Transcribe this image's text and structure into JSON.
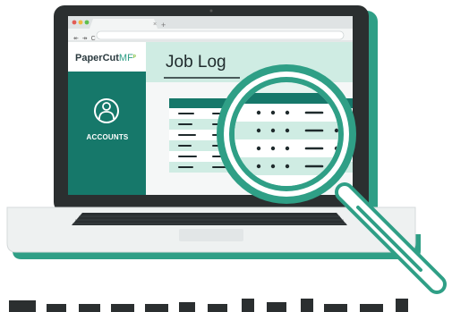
{
  "browser": {
    "tab_close": "×",
    "new_tab": "+",
    "nav_controls": "↞ ↠ C"
  },
  "app": {
    "logo_main": "PaperCut",
    "logo_suffix": "MF",
    "logo_mark": "ᵖ"
  },
  "sidebar": {
    "items": [
      {
        "label": "ACCOUNTS",
        "icon": "user-circle-icon"
      }
    ]
  },
  "main": {
    "title": "Job Log"
  },
  "illustration": {
    "magnifier": "magnifying-glass-icon"
  },
  "colors": {
    "teal_dark": "#16786a",
    "teal": "#2f9f86",
    "teal_light": "#cfece3",
    "laptop_frame": "#2b2f30",
    "keyboard": "#2a2f31"
  }
}
